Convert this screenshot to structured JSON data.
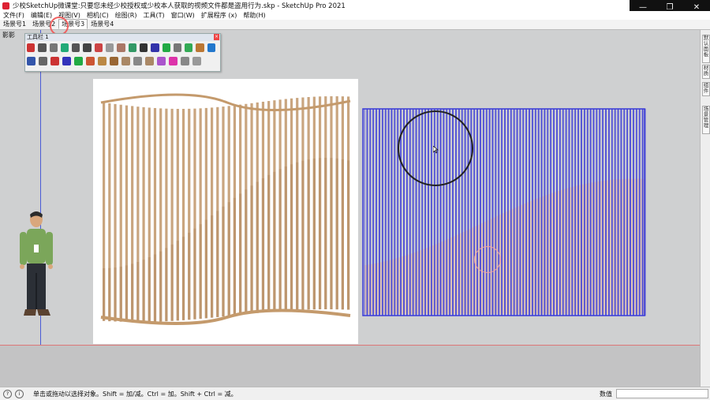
{
  "window": {
    "title": "少校SketchUp微课堂:只要您未经少校授权或少校本人获取的视频文件都是盗用行为.skp - SketchUp Pro 2021",
    "minimize": "—",
    "restore": "❐",
    "close": "✕"
  },
  "menu": [
    "文件(F)",
    "编辑(E)",
    "视图(V)",
    "相机(C)",
    "绘图(R)",
    "工具(T)",
    "窗口(W)",
    "扩展程序 (x)",
    "帮助(H)"
  ],
  "scene_tabs": [
    "场景号1",
    "场景号2",
    "场景号3",
    "场景号4"
  ],
  "active_scene_tab": 2,
  "viewport": {
    "shadow_label": "影影",
    "colors": {
      "blue_axis": "#4a5bd6",
      "red_axis": "#d77777",
      "model_edges": "#3a3ad8",
      "wood": "#c9a57f"
    }
  },
  "toolbar": {
    "title": "工具栏 1",
    "close": "×",
    "row1_icons": [
      "select-icon",
      "arc-icon",
      "scale-icon",
      "rotate-icon",
      "rect-icon",
      "eraser-icon",
      "follow-me-icon",
      "offset-icon",
      "push-pull-icon",
      "move-icon",
      "text-icon",
      "tape-icon",
      "protractor-icon",
      "section-icon",
      "orbit-icon",
      "walk-icon",
      "look-icon"
    ],
    "row1_colors": [
      "#c33",
      "#555",
      "#777",
      "#2a7",
      "#555",
      "#444",
      "#c44",
      "#999",
      "#a76",
      "#396",
      "#333",
      "#33a",
      "#2a4",
      "#777",
      "#3a5",
      "#b73",
      "#27c"
    ],
    "row2_icons": [
      "layers-icon",
      "component-icon",
      "curve-icon",
      "sandbox-drape-icon",
      "stamp-icon",
      "smoove-icon",
      "grid-icon",
      "flip-icon",
      "from-contours-icon",
      "bend-icon",
      "soften-icon",
      "material-icon",
      "paint-icon",
      "tag-icon",
      "folder-icon"
    ],
    "row2_colors": [
      "#35a",
      "#666",
      "#c33",
      "#33b",
      "#2a4",
      "#c53",
      "#b84",
      "#963",
      "#a86",
      "#888",
      "#a86",
      "#a5c",
      "#d3a",
      "#888",
      "#999"
    ]
  },
  "right_panel_tabs": [
    "默认面板",
    "材质",
    "组件",
    "场景管理"
  ],
  "status": {
    "text": "单击或拖动以选择对象。Shift = 加/减。Ctrl = 加。Shift + Ctrl = 减。",
    "measure_label": "数值",
    "measure_value": ""
  }
}
